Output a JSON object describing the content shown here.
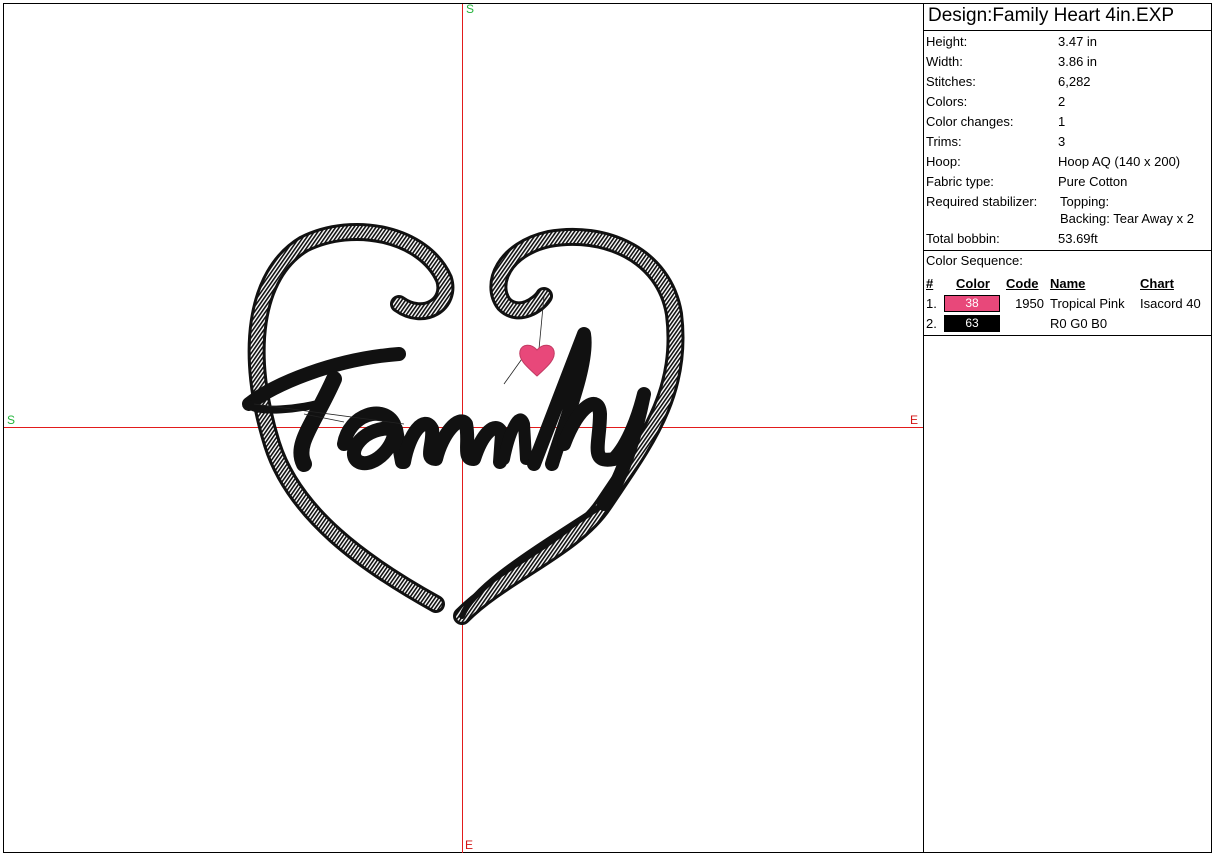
{
  "design": {
    "title": "Design:Family Heart 4in.EXP",
    "properties": [
      {
        "label": "Height:",
        "value": "3.47 in"
      },
      {
        "label": "Width:",
        "value": "3.86 in"
      },
      {
        "label": "Stitches:",
        "value": "6,282"
      },
      {
        "label": "Colors:",
        "value": "2"
      },
      {
        "label": "Color changes:",
        "value": "1"
      },
      {
        "label": "Trims:",
        "value": "3"
      },
      {
        "label": "Hoop:",
        "value": "Hoop AQ (140 x 200)"
      },
      {
        "label": "Fabric type:",
        "value": "Pure Cotton"
      }
    ],
    "stabilizer": {
      "label": "Required stabilizer:",
      "topping": "Topping:",
      "backing": "Backing: Tear Away x 2"
    },
    "bobbin": {
      "label": "Total bobbin:",
      "value": "53.69ft"
    }
  },
  "sequence": {
    "heading": "Color Sequence:",
    "columns": {
      "num": "#",
      "color": "Color",
      "code": "Code",
      "name": "Name",
      "chart": "Chart"
    },
    "rows": [
      {
        "num": "1.",
        "color_num": "38",
        "swatch": "#e8487a",
        "code": "1950",
        "name": "Tropical Pink",
        "chart": "Isacord 40"
      },
      {
        "num": "2.",
        "color_num": "63",
        "swatch": "#000000",
        "code": "",
        "name": "R0 G0 B0",
        "chart": ""
      }
    ]
  },
  "axes": {
    "top": "S",
    "left": "S",
    "right": "E",
    "bottom": "E"
  },
  "artwork": {
    "word": "Family",
    "stitch_color": "#111111",
    "accent_color": "#e8487a",
    "crosshair_color": "#e21b1b"
  }
}
